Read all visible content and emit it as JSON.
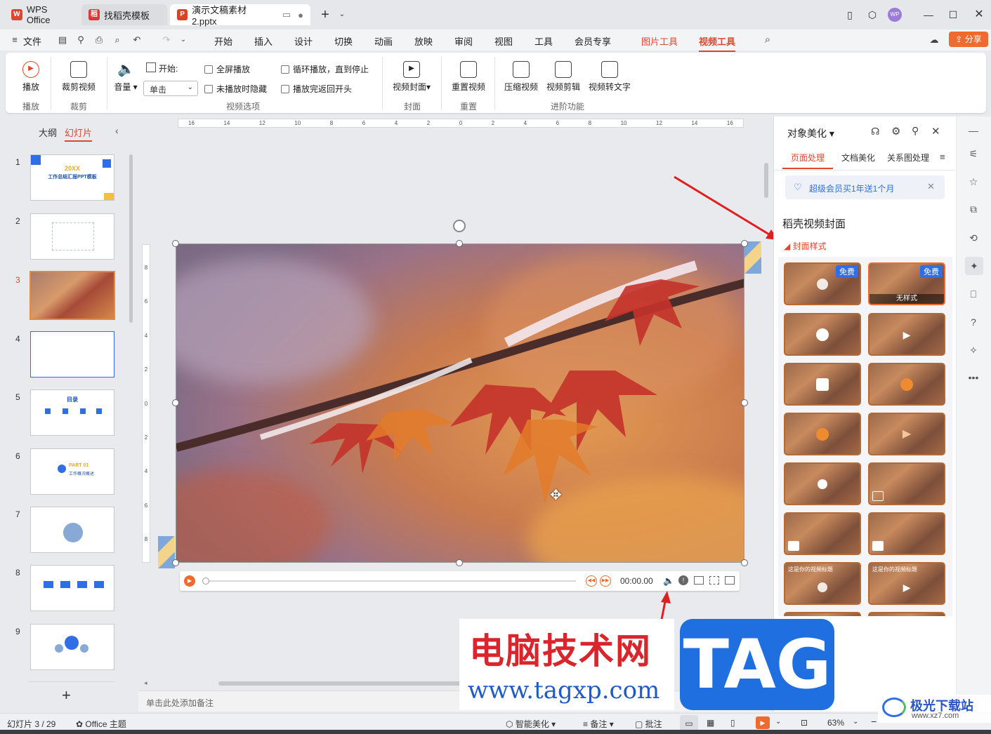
{
  "tabs": [
    {
      "label": "WPS Office"
    },
    {
      "label": "找稻壳模板"
    },
    {
      "label": "演示文稿素材2.pptx"
    }
  ],
  "menu": {
    "file": "文件",
    "items": [
      "开始",
      "插入",
      "设计",
      "切换",
      "动画",
      "放映",
      "审阅",
      "视图",
      "工具",
      "会员专享"
    ],
    "tools": [
      "图片工具",
      "视频工具"
    ],
    "share": "分享"
  },
  "ribbon": {
    "play": "播放",
    "trim": "裁剪视频",
    "volume": "音量",
    "start_label": "开始:",
    "start_value": "单击",
    "fullscreen": "全屏播放",
    "hide": "未播放时隐藏",
    "loop": "循环播放，直到停止",
    "rewind": "播放完返回开头",
    "cover": "视频封面",
    "reset": "重置视频",
    "compress": "压缩视频",
    "edit": "视频剪辑",
    "to_text": "视频转文字",
    "groups": {
      "play": "播放",
      "trim": "裁剪",
      "options": "视频选项",
      "cover": "封面",
      "reset": "重置",
      "advanced": "进阶功能"
    }
  },
  "left": {
    "outline": "大纲",
    "slides": "幻灯片",
    "numbers": [
      "1",
      "2",
      "3",
      "4",
      "5",
      "6",
      "7",
      "8",
      "9"
    ],
    "add": "+",
    "s1_title": "20XX",
    "s1_sub": "工作总结汇报PPT模板",
    "s5_title": "目录",
    "s6_title": "PART 01",
    "s6_sub": "工作概况概述"
  },
  "canvas": {
    "time": "00:00.00",
    "notes_placeholder": "单击此处添加备注",
    "ruler": [
      "16",
      "14",
      "12",
      "10",
      "8",
      "6",
      "4",
      "2",
      "0",
      "2",
      "4",
      "6",
      "8",
      "10",
      "12",
      "14",
      "16"
    ],
    "vruler": [
      "8",
      "6",
      "4",
      "2",
      "0",
      "2",
      "4",
      "6",
      "8"
    ]
  },
  "right": {
    "title": "对象美化",
    "tabs": [
      "页面处理",
      "文档美化",
      "关系图处理"
    ],
    "promo": "超级会员买1年送1个月",
    "section": "稻壳视频封面",
    "subsection": "封面样式",
    "free": "免费",
    "no_style": "无样式",
    "caption": "这是你的视频标题"
  },
  "status": {
    "slide": "幻灯片 3 / 29",
    "theme": "Office 主题",
    "beautify": "智能美化",
    "notes": "备注",
    "comment": "批注",
    "zoom": "63%"
  },
  "watermark": {
    "cn": "电脑技术网",
    "url": "www.tagxp.com",
    "tag": "TAG",
    "site": "极光下载站",
    "site_url": "www.xz7.com"
  },
  "colors": {
    "accent": "#e0462c",
    "blue": "#2f6ee6"
  }
}
